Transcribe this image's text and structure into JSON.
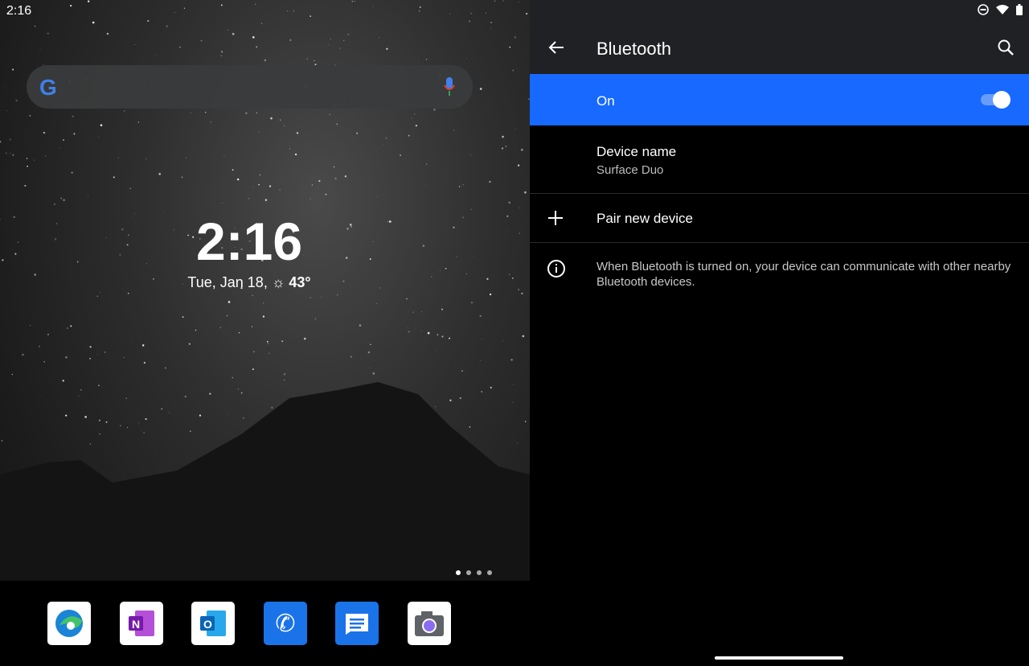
{
  "home": {
    "status_time": "2:16",
    "clock": "2:16",
    "date": "Tue, Jan 18,",
    "weather_icon": "sun-icon",
    "temperature": "43°",
    "search_logo": "G",
    "page_count": 4,
    "current_page": 1,
    "dock": [
      {
        "name": "Microsoft Edge",
        "icon": "edge-icon"
      },
      {
        "name": "OneNote",
        "icon": "onenote-icon"
      },
      {
        "name": "Outlook",
        "icon": "outlook-icon"
      },
      {
        "name": "Phone",
        "icon": "phone-icon"
      },
      {
        "name": "Messages",
        "icon": "messages-icon"
      },
      {
        "name": "Camera",
        "icon": "camera-icon"
      }
    ]
  },
  "settings": {
    "title": "Bluetooth",
    "toggle_label": "On",
    "toggle_on": true,
    "accent": "#1769ff",
    "device_name_label": "Device name",
    "device_name": "Surface Duo",
    "pair_label": "Pair new device",
    "info_text": "When Bluetooth is turned on, your device can communicate with other nearby Bluetooth devices.",
    "wifi_badge": "4"
  }
}
